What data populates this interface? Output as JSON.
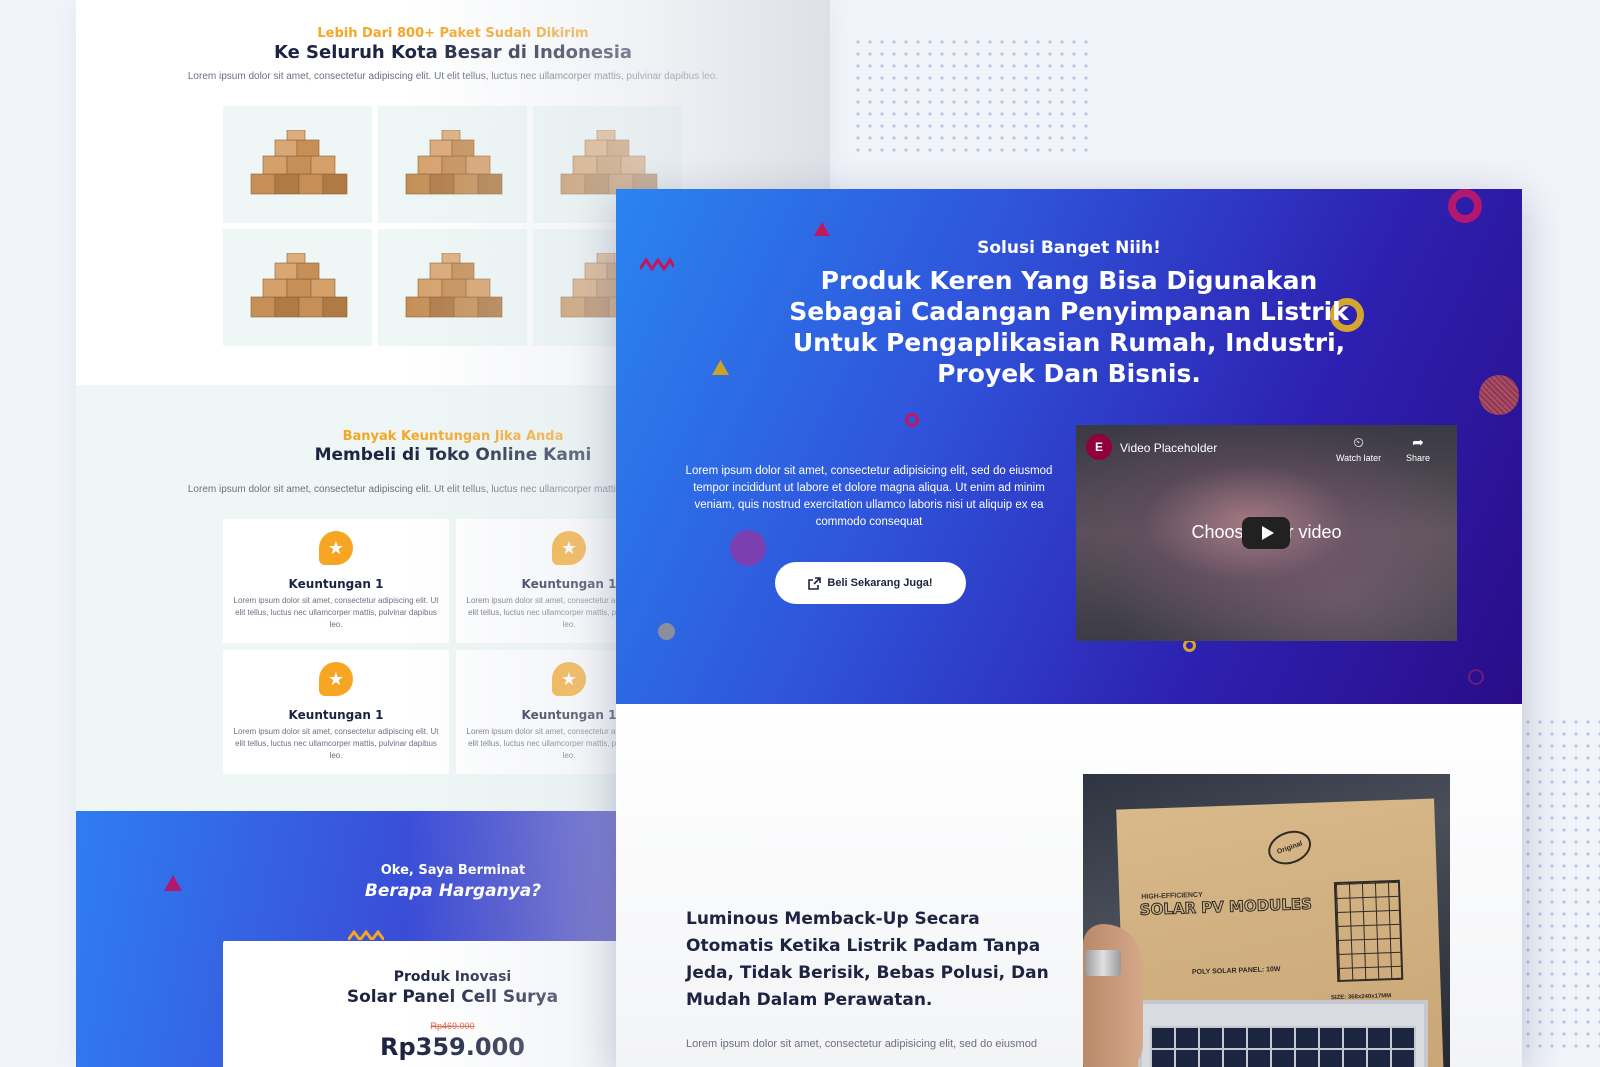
{
  "back_page": {
    "shipping": {
      "kicker": "Lebih Dari 800+ Paket Sudah Dikirim",
      "title": "Ke Seluruh Kota Besar di Indonesia",
      "desc": "Lorem ipsum dolor sit amet, consectetur adipiscing elit. Ut elit tellus, luctus nec ullamcorper mattis, pulvinar dapibus leo."
    },
    "benefits": {
      "kicker": "Banyak Keuntungan Jika Anda",
      "title": "Membeli di Toko Online Kami",
      "desc": "Lorem ipsum dolor sit amet, consectetur adipiscing elit. Ut elit tellus, luctus nec ullamcorper mattis, pulvinar dapibus leo.",
      "items": [
        {
          "title": "Keuntungan 1",
          "desc": "Lorem ipsum dolor sit amet, consectetur adipiscing elit. Ut elit tellus, luctus nec ullamcorper mattis, pulvinar dapibus leo."
        },
        {
          "title": "Keuntungan 1",
          "desc": "Lorem ipsum dolor sit amet, consectetur adipiscing elit. Ut elit tellus, luctus nec ullamcorper mattis, pulvinar dapibus leo."
        },
        {
          "title": "Keuntungan 1",
          "desc": "Lorem ipsum dolor sit amet, consectetur adipiscing elit. Ut elit tellus, luctus nec ullamcorper mattis, pulvinar dapibus leo."
        },
        {
          "title": "Keuntungan 1",
          "desc": "Lorem ipsum dolor sit amet, consectetur adipiscing elit. Ut elit tellus, luctus nec ullamcorper mattis, pulvinar dapibus leo."
        }
      ]
    },
    "pricing": {
      "kicker": "Oke, Saya Berminat",
      "title": "Berapa Harganya?",
      "card_kicker": "Produk Inovasi",
      "card_title": "Solar Panel Cell Surya",
      "old_price": "Rp469.000",
      "price": "Rp359.000"
    }
  },
  "front_page": {
    "hero": {
      "kicker": "Solusi Banget Niih!",
      "title": "Produk Keren Yang Bisa Digunakan Sebagai Cadangan Penyimpanan Listrik Untuk Pengaplikasian Rumah, Industri, Proyek Dan Bisnis.",
      "desc": "Lorem ipsum dolor sit amet, consectetur adipisicing elit, sed do eiusmod tempor incididunt ut labore et dolore magna aliqua. Ut enim ad minim veniam, quis nostrud exercitation ullamco laboris nisi ut aliquip ex ea commodo consequat",
      "cta_label": "Beli Sekarang Juga!",
      "cta_icon": "external-link-icon"
    },
    "video": {
      "title": "Video Placeholder",
      "logo": "E",
      "watch_later": "Watch later",
      "share": "Share",
      "placeholder": "Choose your video"
    },
    "product": {
      "title": "Luminous Memback-Up Secara Otomatis Ketika Listrik Padam Tanpa Jeda, Tidak Berisik, Bebas Polusi, Dan Mudah Dalam Perawatan.",
      "desc": "Lorem ipsum dolor sit amet, consectetur adipisicing elit, sed do eiusmod",
      "box_badge": "Original",
      "box_sub": "HIGH-EFFICIENCY",
      "box_title": "SOLAR PV MODULES",
      "box_poly": "POLY SOLAR PANEL: 10W",
      "box_size": "SIZE: 368x240x17MM"
    }
  },
  "colors": {
    "accent": "#f6a623",
    "heading": "#1d2340",
    "hero_start": "#2a84f0",
    "hero_end": "#2a0c87",
    "magenta": "#b3176f"
  }
}
